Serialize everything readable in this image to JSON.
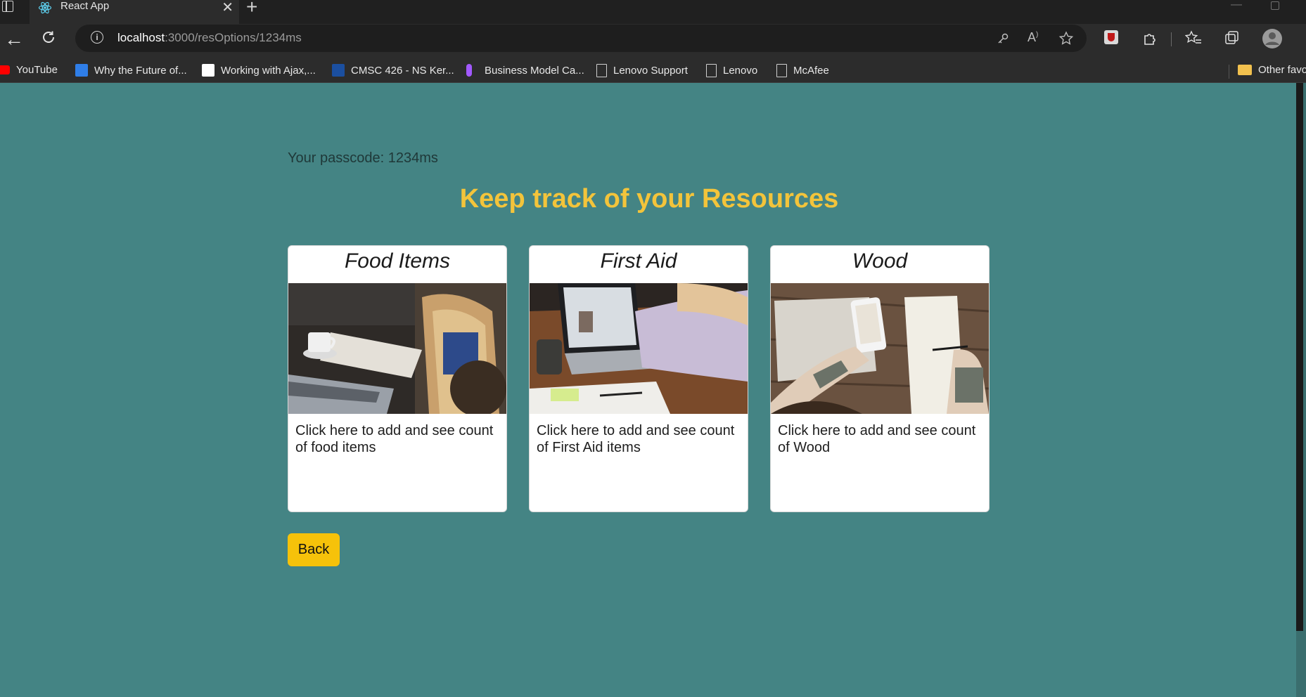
{
  "browser": {
    "tab_title": "React App",
    "tab_close": "✕",
    "new_tab": "+",
    "url_host": "localhost",
    "url_path": ":3000/resOptions/1234ms",
    "info": "i"
  },
  "bookmarks": [
    {
      "label": "YouTube",
      "icon": "youtube-icon",
      "color": "#ff0000"
    },
    {
      "label": "Why the Future of...",
      "icon": "site-icon",
      "color": "#2f7ee8"
    },
    {
      "label": "Working with Ajax,...",
      "icon": "w3schools-icon",
      "color": "#ffffff"
    },
    {
      "label": "CMSC 426 - NS Ker...",
      "icon": "site-icon",
      "color": "#1b4fa0"
    },
    {
      "label": "Business Model Ca...",
      "icon": "figma-icon",
      "color": "#a259ff"
    },
    {
      "label": "Lenovo Support",
      "icon": "page-icon",
      "color": "#cfcfcf"
    },
    {
      "label": "Lenovo",
      "icon": "page-icon",
      "color": "#cfcfcf"
    },
    {
      "label": "McAfee",
      "icon": "page-icon",
      "color": "#cfcfcf"
    }
  ],
  "other_favorites": "Other favo",
  "main": {
    "passcode_text": "Your passcode: 1234ms",
    "heading": "Keep track of your Resources",
    "cards": [
      {
        "title": "Food Items",
        "text": "Click here to add and see count of food items"
      },
      {
        "title": "First Aid",
        "text": "Click here to add and see count of First Aid items"
      },
      {
        "title": "Wood",
        "text": "Click here to add and see count of Wood"
      }
    ],
    "back_label": "Back"
  },
  "colors": {
    "page_bg": "#448484",
    "heading": "#f3c43b",
    "back_button": "#f6c20a"
  }
}
